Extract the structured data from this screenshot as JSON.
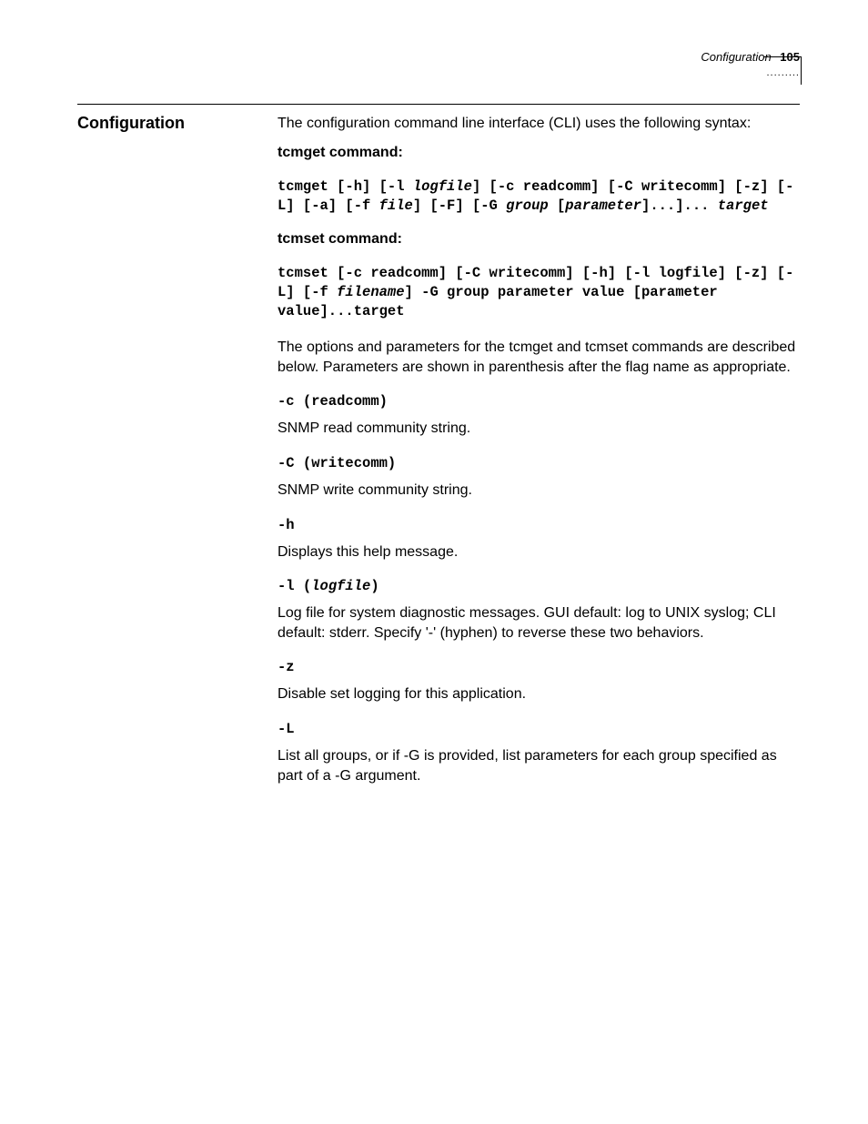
{
  "header": {
    "running_title": "Configuration",
    "page_number": "105",
    "dots": "........."
  },
  "section_title": "Configuration",
  "intro": "The configuration command line interface (CLI) uses the following syntax:",
  "tcmget": {
    "label": "tcmget command:",
    "syntax_pre": "tcmget [-h] [-l ",
    "syntax_logfile": "logfile",
    "syntax_mid1": "] [-c readcomm] [-C writecomm] [-z] [-L] [-a] [-f ",
    "syntax_file": "file",
    "syntax_mid2": "] [-F] [-G ",
    "syntax_group": "group",
    "syntax_mid3": " [",
    "syntax_parameter": "parameter",
    "syntax_mid4": "]...]... ",
    "syntax_target": "target"
  },
  "tcmset": {
    "label": "tcmset command:",
    "syntax_pre": "tcmset [-c readcomm] [-C writecomm] [-h] [-l logfile] [-z] [-L] [-f ",
    "syntax_filename": "filename",
    "syntax_post": "] -G group parameter value [parameter value]...target"
  },
  "options_intro": "The options and parameters for the tcmget and tcmset commands are described below. Parameters are shown in parenthesis after the flag name as appropriate.",
  "options": {
    "c_flag": "-c (readcomm)",
    "c_desc": "SNMP read community string.",
    "C_flag": "-C (writecomm)",
    "C_desc": "SNMP write community string.",
    "h_flag": "-h",
    "h_desc": "Displays this help message.",
    "l_flag_pre": "-l (",
    "l_flag_arg": "logfile",
    "l_flag_post": ")",
    "l_desc": "Log file for system diagnostic messages. GUI default: log to UNIX syslog; CLI default: stderr. Specify '-' (hyphen) to reverse these two behaviors.",
    "z_flag": "-z",
    "z_desc": "Disable set logging for this application.",
    "L_flag": "-L",
    "L_desc": "List all groups, or if -G is provided, list parameters for each group specified as part of a -G argument."
  }
}
